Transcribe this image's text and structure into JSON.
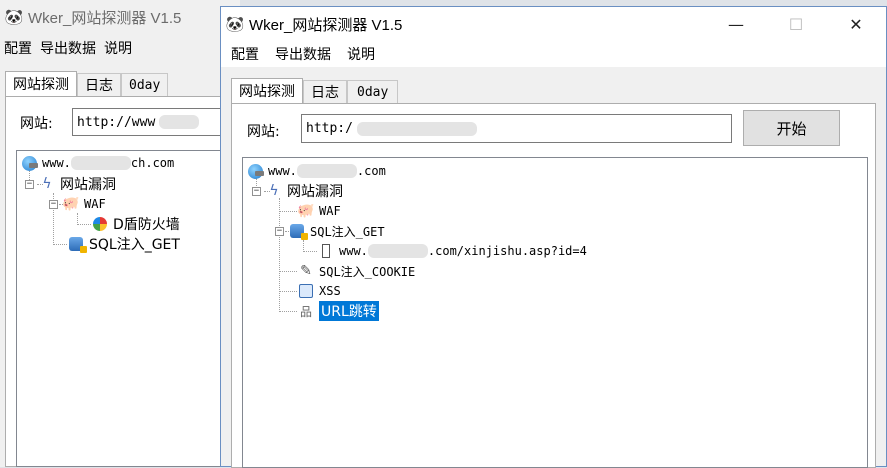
{
  "back_window": {
    "title": "Wker_网站探测器 V1.5",
    "menu": [
      "配置",
      "导出数据",
      "说明"
    ],
    "tabs": [
      "网站探测",
      "日志",
      "0day"
    ],
    "url_label": "网站:",
    "url_value": "http://www",
    "tree": {
      "root_prefix": "www.",
      "root_suffix": "ch.com",
      "vuln": "网站漏洞",
      "waf": "WAF",
      "waf_child": "D盾防火墙",
      "sql_get": "SQL注入_GET"
    }
  },
  "front_window": {
    "title": "Wker_网站探测器 V1.5",
    "menu": [
      "配置",
      "导出数据",
      "说明"
    ],
    "tabs": [
      "网站探测",
      "日志",
      "0day"
    ],
    "url_label": "网站:",
    "url_value": "http:/",
    "start_button": "开始",
    "tree": {
      "root_prefix": "www.",
      "root_suffix": ".com",
      "vuln": "网站漏洞",
      "waf": "WAF",
      "sql_get": "SQL注入_GET",
      "sql_get_child_prefix": "www.",
      "sql_get_child_suffix": ".com/xinjishu.asp?id=4",
      "sql_cookie": "SQL注入_COOKIE",
      "xss": "XSS",
      "url_jump": "URL跳转"
    }
  },
  "icons": {
    "app": "panda-icon",
    "minimize": "minimize-icon",
    "maximize": "maximize-icon",
    "close": "close-icon"
  },
  "colors": {
    "selection": "#0078d7",
    "window_border": "#6a8fc2"
  }
}
